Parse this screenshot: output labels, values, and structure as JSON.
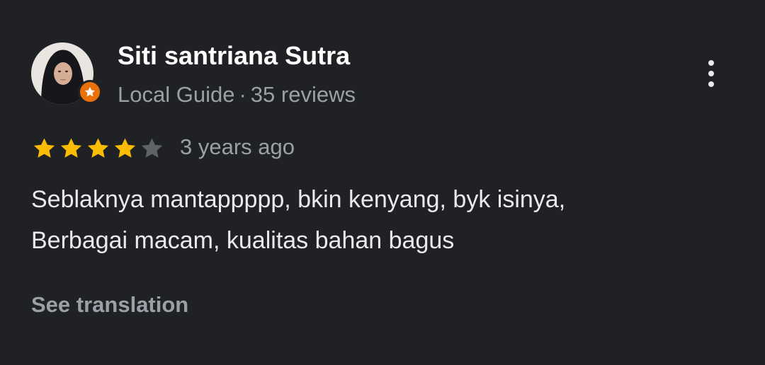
{
  "reviewer": {
    "name": "Siti santriana Sutra",
    "badge": "Local Guide",
    "separator": "·",
    "review_count": "35 reviews"
  },
  "review": {
    "rating": 4,
    "max_rating": 5,
    "date": "3 years ago",
    "text_lines": [
      "Seblaknya mantappppp, bkin kenyang, byk isinya,",
      "Berbagai macam, kualitas bahan bagus"
    ]
  },
  "actions": {
    "see_translation": "See translation"
  },
  "icons": {
    "more": "more-vert-icon",
    "badge": "local-guide-star-icon",
    "star": "star-icon"
  },
  "colors": {
    "background": "#202124",
    "star_filled": "#fbbc04",
    "star_empty": "#5f6368",
    "badge": "#e8710a",
    "muted_text": "#9aa0a6"
  }
}
